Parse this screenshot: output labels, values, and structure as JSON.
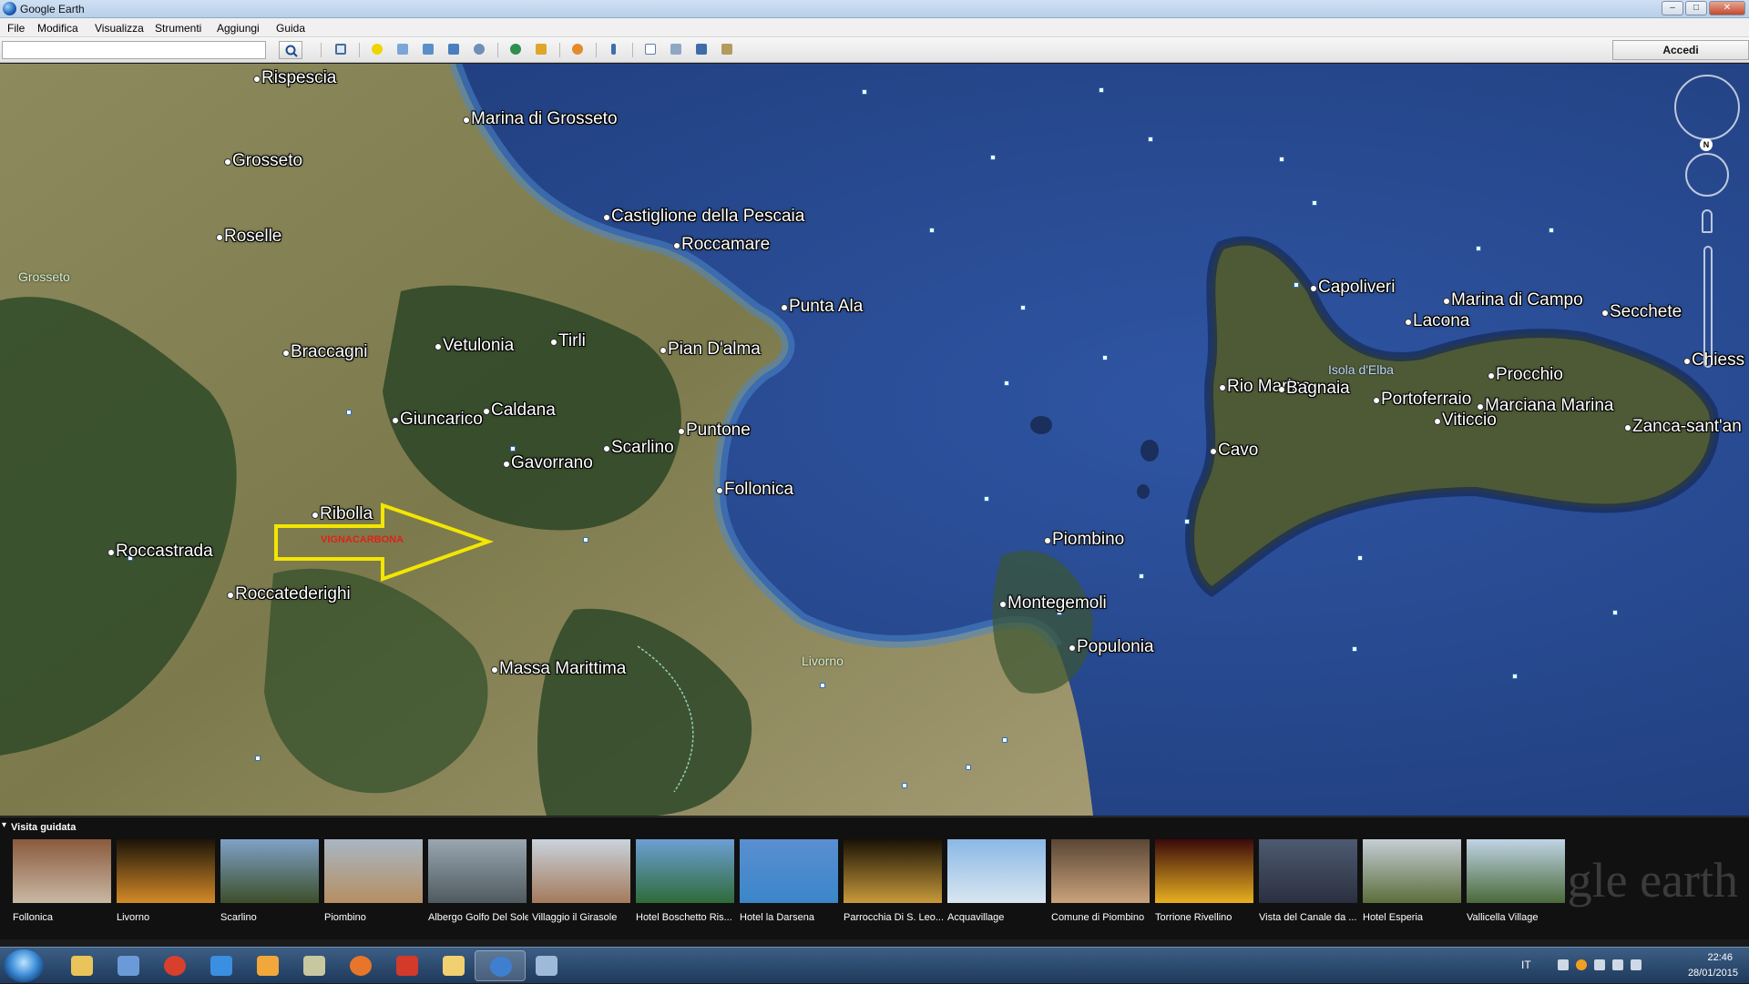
{
  "window": {
    "title": "Google Earth"
  },
  "menu": [
    "File",
    "Modifica",
    "Visualizza",
    "Strumenti",
    "Aggiungi",
    "Guida"
  ],
  "toolbar": {
    "search_value": "",
    "signin_label": "Accedi",
    "icons": [
      "sidebar-toggle-icon",
      "placemark-icon",
      "polygon-icon",
      "path-icon",
      "image-overlay-icon",
      "record-tour-icon",
      "historical-imagery-icon",
      "sunlight-icon",
      "planets-icon",
      "ruler-icon",
      "email-icon",
      "print-icon",
      "save-image-icon",
      "view-in-maps-icon"
    ]
  },
  "map": {
    "places": [
      {
        "name": "Rispescia",
        "size": "large"
      },
      {
        "name": "Marina di Grosseto",
        "size": "large"
      },
      {
        "name": "Grosseto",
        "size": "large"
      },
      {
        "name": "Castiglione della Pescaia",
        "size": "large"
      },
      {
        "name": "Roccamare",
        "size": "large"
      },
      {
        "name": "Roselle",
        "size": "large"
      },
      {
        "name": "Punta Ala",
        "size": "large"
      },
      {
        "name": "Braccagni",
        "size": "large"
      },
      {
        "name": "Vetulonia",
        "size": "large"
      },
      {
        "name": "Tirli",
        "size": "large"
      },
      {
        "name": "Pian D'alma",
        "size": "large"
      },
      {
        "name": "Caldana",
        "size": "large"
      },
      {
        "name": "Giuncarico",
        "size": "large"
      },
      {
        "name": "Puntone",
        "size": "large"
      },
      {
        "name": "Scarlino",
        "size": "large"
      },
      {
        "name": "Gavorrano",
        "size": "large"
      },
      {
        "name": "Follonica",
        "size": "large"
      },
      {
        "name": "Ribolla",
        "size": "large"
      },
      {
        "name": "Roccastrada",
        "size": "large"
      },
      {
        "name": "Roccatederighi",
        "size": "large"
      },
      {
        "name": "Massa Marittima",
        "size": "large"
      },
      {
        "name": "Piombino",
        "size": "large"
      },
      {
        "name": "Montegemoli",
        "size": "large"
      },
      {
        "name": "Populonia",
        "size": "large"
      },
      {
        "name": "Capoliveri",
        "size": "large"
      },
      {
        "name": "Marina di Campo",
        "size": "large"
      },
      {
        "name": "Lacona",
        "size": "large"
      },
      {
        "name": "Secchete",
        "size": "large"
      },
      {
        "name": "Chiess",
        "size": "large"
      },
      {
        "name": "Rio Marina",
        "size": "large"
      },
      {
        "name": "Bagnaia",
        "size": "large"
      },
      {
        "name": "Procchio",
        "size": "large"
      },
      {
        "name": "Portoferraio",
        "size": "large"
      },
      {
        "name": "Marciana Marina",
        "size": "large"
      },
      {
        "name": "Viticcio",
        "size": "large"
      },
      {
        "name": "Zanca-sant'an",
        "size": "large"
      },
      {
        "name": "Cavo",
        "size": "large"
      }
    ],
    "regions": [
      {
        "name": "Grosseto",
        "tone": "green"
      },
      {
        "name": "Isola d'Elba",
        "tone": "blue"
      },
      {
        "name": "Livorno",
        "tone": "green"
      }
    ],
    "annotation": {
      "text": "VIGNACARBONA",
      "arrow_color": "#f3e600"
    },
    "north_label": "N"
  },
  "tour": {
    "header": "Visita guidata",
    "items": [
      {
        "caption": "Follonica",
        "colors": [
          "#8a5a3c",
          "#c9b8a4"
        ]
      },
      {
        "caption": "Livorno",
        "colors": [
          "#1c1408",
          "#d48a28"
        ]
      },
      {
        "caption": "Scarlino",
        "colors": [
          "#7fa1c8",
          "#3d4f2a"
        ]
      },
      {
        "caption": "Piombino",
        "colors": [
          "#a9b6c4",
          "#b58f62"
        ]
      },
      {
        "caption": "Albergo Golfo Del Sole",
        "colors": [
          "#9aa6b0",
          "#4f5a60"
        ]
      },
      {
        "caption": "Villaggio il Girasole",
        "colors": [
          "#c9d3dc",
          "#a47a5c"
        ]
      },
      {
        "caption": "Hotel Boschetto Ris...",
        "colors": [
          "#6c9fd4",
          "#2f6b3a"
        ]
      },
      {
        "caption": "Hotel la Darsena",
        "colors": [
          "#5a8fd0",
          "#3a86c9"
        ]
      },
      {
        "caption": "Parrocchia Di S. Leo...",
        "colors": [
          "#1a1206",
          "#c79a3a"
        ]
      },
      {
        "caption": "Acquavillage",
        "colors": [
          "#8ab8e6",
          "#d9e6f0"
        ]
      },
      {
        "caption": "Comune di Piombino",
        "colors": [
          "#5a4636",
          "#c9a27a"
        ]
      },
      {
        "caption": "Torrione Rivellino",
        "colors": [
          "#3a0a0a",
          "#e8b020"
        ]
      },
      {
        "caption": "Vista del Canale da ...",
        "colors": [
          "#4d5a70",
          "#2b3040"
        ]
      },
      {
        "caption": "Hotel Esperia",
        "colors": [
          "#c5ced6",
          "#5c6e3c"
        ]
      },
      {
        "caption": "Vallicella Village",
        "colors": [
          "#c0d4e6",
          "#4a6a3a"
        ]
      }
    ],
    "watermark": "gle earth"
  },
  "taskbar": {
    "apps": [
      "file-explorer-icon",
      "media-icon",
      "chrome-icon",
      "internet-explorer-icon",
      "media-player-icon",
      "archive-icon",
      "firefox-icon",
      "cc4-icon",
      "folder-icon",
      "google-earth-icon",
      "paint-icon"
    ],
    "language": "IT",
    "time": "22:46",
    "date": "28/01/2015"
  }
}
